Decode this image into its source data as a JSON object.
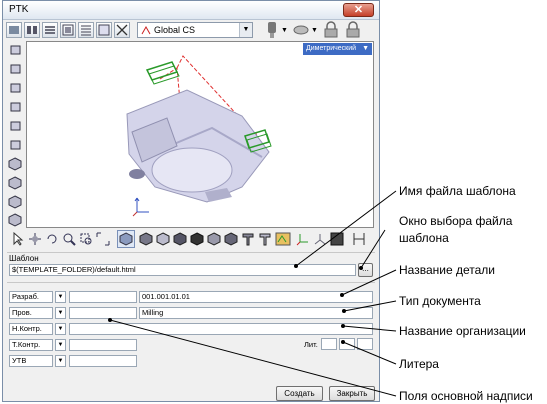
{
  "window": {
    "title": "PTK",
    "close_glyph": "✕"
  },
  "toolbar": {
    "coordinate_system": "Global CS"
  },
  "viewport": {
    "view_mode": "Диметрический",
    "icons": [
      "model-3d-icon",
      "axis-triad-icon"
    ]
  },
  "template": {
    "label": "Шаблон",
    "path": "$(TEMPLATE_FOLDER)/default.html",
    "browse_label": "..."
  },
  "title_block": {
    "rows": [
      {
        "role": "Разраб.",
        "name": "",
        "right": "001.001.01.01"
      },
      {
        "role": "Пров.",
        "name": "",
        "right": "Milling"
      },
      {
        "role": "Н.Контр.",
        "name": "",
        "right": ""
      },
      {
        "role": "Т.Контр.",
        "name": "",
        "right": ""
      },
      {
        "role": "УТВ",
        "name": "",
        "right": ""
      }
    ],
    "lit_label": "Лит."
  },
  "buttons": {
    "create": "Создать",
    "close": "Закрыть"
  },
  "annotations": [
    "Имя файла шаблона",
    "Окно выбора файла",
    "шаблона",
    "Название детали",
    "Тип документа",
    "Название организации",
    "Литера",
    "Поля основной надписи"
  ],
  "colors": {
    "accent": "#3d6bc4",
    "model": "#d0d0e8",
    "highlight": "#2a9a2a",
    "dashed": "#e03030"
  }
}
